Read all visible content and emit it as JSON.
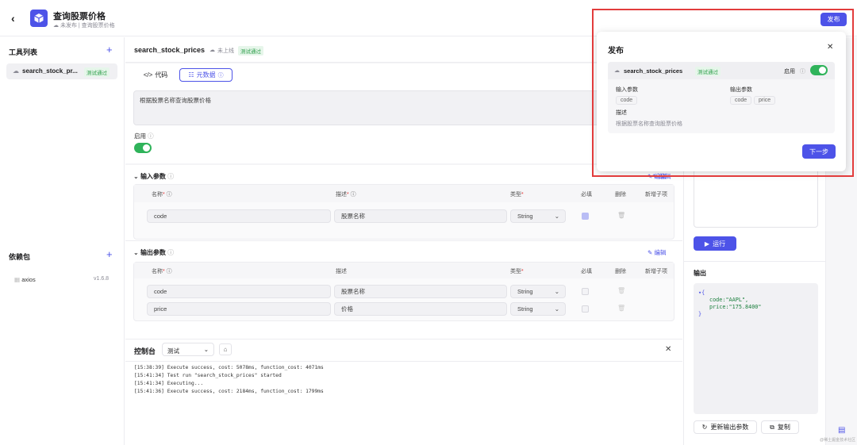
{
  "header": {
    "title": "查询股票价格",
    "status": "未发布",
    "breadcrumb": "查询股票价格",
    "publish_label": "发布"
  },
  "sidebar": {
    "tools_title": "工具列表",
    "tool_item": {
      "name": "search_stock_pr...",
      "badge": "测试通过"
    },
    "deps_title": "依赖包",
    "dep": {
      "name": "axios",
      "version": "v1.6.8"
    }
  },
  "tool": {
    "name": "search_stock_prices",
    "upload_status": "未上线",
    "badge": "测试通过",
    "tab_code": "代码",
    "tab_meta": "元数据",
    "description": "根据股票名称查询股票价格",
    "enable_label": "启用"
  },
  "input_params": {
    "title": "输入参数",
    "edit_label": "编辑",
    "headers": {
      "name": "名称",
      "desc": "描述",
      "type": "类型",
      "required": "必填",
      "delete": "删除",
      "add_child": "新增子项"
    },
    "rows": [
      {
        "name": "code",
        "desc": "股票名称",
        "type": "String",
        "required": true
      }
    ]
  },
  "output_params": {
    "title": "输出参数",
    "edit_label": "编辑",
    "headers": {
      "name": "名称",
      "desc": "描述",
      "type": "类型",
      "required": "必填",
      "delete": "删除",
      "add_child": "新增子项"
    },
    "rows": [
      {
        "name": "code",
        "desc": "股票名称",
        "type": "String",
        "required": false
      },
      {
        "name": "price",
        "desc": "价格",
        "type": "String",
        "required": false
      }
    ]
  },
  "console": {
    "title": "控制台",
    "mode": "测试",
    "logs": [
      "[15:38:39] Execute success, cost: 5078ms, function_cost: 4071ms",
      "[15:41:34] Test run \"search_stock_prices\" started",
      "[15:41:34] Executing...",
      "[15:41:36] Execute success, cost: 2184ms, function_cost: 1799ms"
    ]
  },
  "run_panel": {
    "edit_label": "编辑",
    "run_label": "运行",
    "output_title": "输出",
    "output_lines": [
      "▾{",
      "code:\"AAPL\",",
      "price:\"175.8400\"",
      "}"
    ],
    "refresh_label": "更新输出参数",
    "copy_label": "复制"
  },
  "popup": {
    "title": "发布",
    "tool_name": "search_stock_prices",
    "badge": "测试通过",
    "enable_label": "启用",
    "input_label": "输入参数",
    "input_pills": [
      "code"
    ],
    "output_label": "输出参数",
    "output_pills": [
      "code",
      "price"
    ],
    "desc_label": "描述",
    "desc_value": "根据股票名称查询股票价格",
    "next_label": "下一步"
  },
  "watermark": "@稀土掘金技术社区"
}
